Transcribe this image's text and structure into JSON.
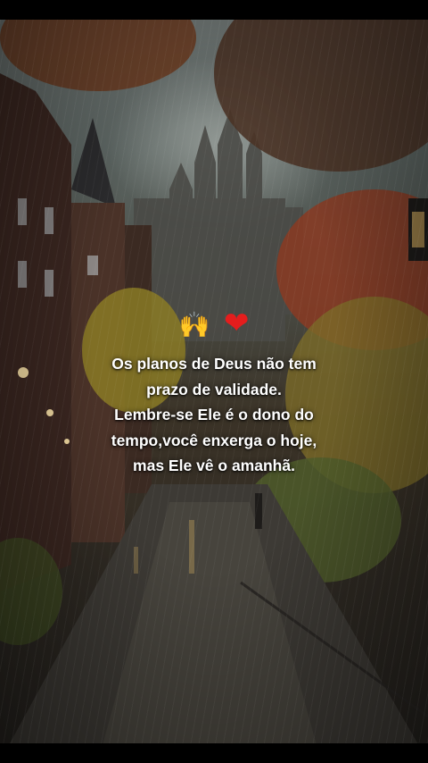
{
  "emojis": {
    "hands": "🙌",
    "heart": "❤"
  },
  "quote": {
    "lines": [
      "Os planos de Deus não tem",
      "prazo de validade.",
      "Lembre-se Ele é o dono do",
      "tempo,você enxerga o hoje,",
      "mas Ele vê o amanhã."
    ]
  },
  "colors": {
    "heart": "#e51d1d",
    "text": "#ffffff"
  }
}
